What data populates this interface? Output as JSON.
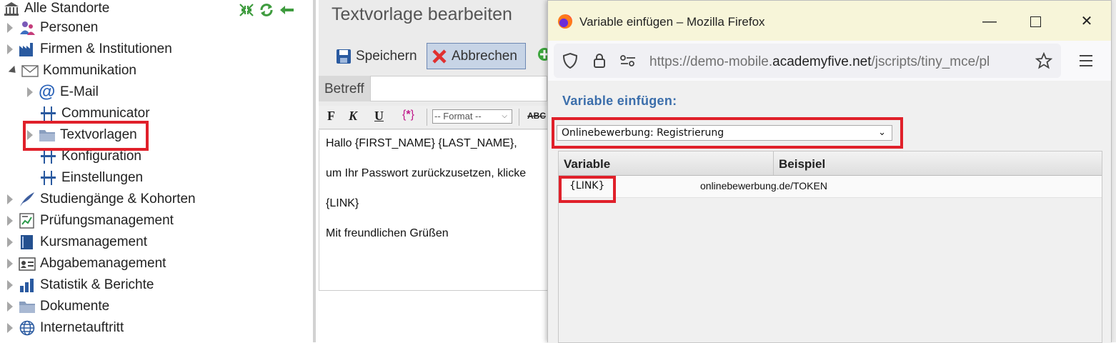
{
  "sidebar": {
    "root_label": "Alle Standorte",
    "items": [
      {
        "label": "Personen"
      },
      {
        "label": "Firmen & Institutionen"
      },
      {
        "label": "Kommunikation"
      },
      {
        "label": "E-Mail"
      },
      {
        "label": "Communicator"
      },
      {
        "label": "Textvorlagen"
      },
      {
        "label": "Konfiguration"
      },
      {
        "label": "Einstellungen"
      },
      {
        "label": "Studiengänge & Kohorten"
      },
      {
        "label": "Prüfungsmanagement"
      },
      {
        "label": "Kursmanagement"
      },
      {
        "label": "Abgabemanagement"
      },
      {
        "label": "Statistik & Berichte"
      },
      {
        "label": "Dokumente"
      },
      {
        "label": "Internetauftritt"
      }
    ]
  },
  "main": {
    "title": "Textvorlage bearbeiten",
    "save_label": "Speichern",
    "cancel_label": "Abbrechen",
    "subject_label": "Betreff",
    "format_select": "-- Format --",
    "editor_lines": [
      "Hallo {FIRST_NAME} {LAST_NAME},",
      "um Ihr Passwort zurückzusetzen, klicke",
      "{LINK}",
      "Mit freundlichen Grüßen"
    ]
  },
  "popup": {
    "window_title": "Variable einfügen – Mozilla Firefox",
    "url_prefix": "https://demo-mobile.",
    "url_domain": "academyfive.net",
    "url_path": "/jscripts/tiny_mce/pl",
    "heading": "Variable einfügen:",
    "select_value": "Onlinebewerbung: Registrierung",
    "columns": [
      "Variable",
      "Beispiel"
    ],
    "rows": [
      {
        "variable": "{LINK}",
        "example": "onlinebewerbung.de/TOKEN"
      }
    ]
  },
  "colors": {
    "highlight": "#e0202a",
    "heading_blue": "#3b6eab",
    "titlebar_bg": "#f7f5d9"
  }
}
